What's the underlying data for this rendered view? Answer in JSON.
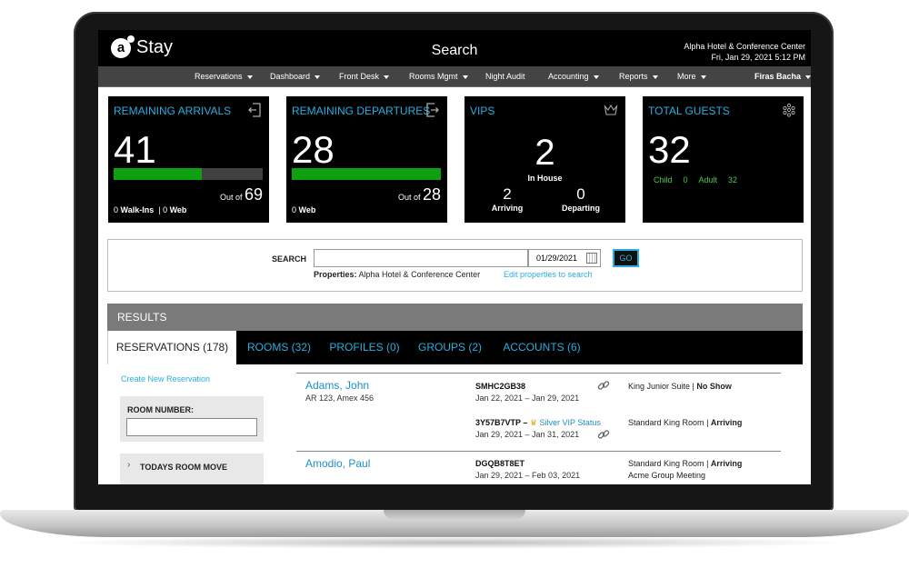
{
  "app": {
    "logo_text": "Stay",
    "logo_mark": "a",
    "page_title": "Search",
    "hotel_name": "Alpha Hotel & Conference Center",
    "datetime": "Fri, Jan 29, 2021 5:12 PM"
  },
  "nav": {
    "items": [
      "Reservations",
      "Dashboard",
      "Front Desk",
      "Rooms Mgmt",
      "Night Audit",
      "Accounting",
      "Reports",
      "More"
    ],
    "user": "Firas Bacha"
  },
  "cards": {
    "arrivals": {
      "title": "REMAINING ARRIVALS",
      "icon": "exit-door-icon",
      "value": "41",
      "out_of_label": "Out of",
      "total": "69",
      "progress": 0.59,
      "walkins": "0",
      "walkins_label": "Walk-Ins",
      "web": "0",
      "web_label": "Web"
    },
    "departures": {
      "title": "REMAINING DEPARTURES",
      "icon": "exit-door-icon",
      "value": "28",
      "out_of_label": "Out of",
      "total": "28",
      "progress": 1.0,
      "web": "0",
      "web_label": "Web"
    },
    "vips": {
      "title": "VIPS",
      "icon": "crown-icon",
      "in_house": "2",
      "in_house_label": "In House",
      "arriving": "2",
      "arriving_label": "Arriving",
      "departing": "0",
      "departing_label": "Departing"
    },
    "guests": {
      "title": "TOTAL GUESTS",
      "icon": "grid-icon",
      "value": "32",
      "child_label": "Child",
      "child": "0",
      "adult_label": "Adult",
      "adult": "32"
    }
  },
  "search": {
    "label": "SEARCH",
    "value": "",
    "date": "01/29/2021",
    "go_label": "GO",
    "properties_label": "Properties:",
    "properties_value": "Alpha Hotel & Conference Center",
    "edit_link": "Edit properties to search"
  },
  "results": {
    "header": "RESULTS",
    "tabs": [
      "RESERVATIONS (178)",
      "ROOMS (32)",
      "PROFILES (0)",
      "GROUPS (2)",
      "ACCOUNTS (6)"
    ],
    "create_link": "Create New Reservation",
    "room_number_label": "ROOM NUMBER:",
    "room_number_value": "",
    "room_move_label": "TODAYS ROOM MOVE",
    "rows": [
      {
        "name": "Adams, John",
        "detail": "AR 123, Amex 456",
        "conf": "SMHC2GB38",
        "dates": "Jan 22, 2021 – Jan 29, 2021",
        "room": "King Junior Suite",
        "status": "No Show"
      },
      {
        "conf": "3Y57B7VTP",
        "vip": "Silver VIP Status",
        "dates": "Jan 29, 2021 – Jan 31, 2021",
        "room": "Standard King Room",
        "status": "Arriving"
      },
      {
        "name": "Amodio, Paul",
        "conf": "DGQB8T8ET",
        "dates": "Jan 29, 2021 – Feb 03, 2021",
        "room": "Standard King Room",
        "status": "Arriving",
        "group": "Acme Group Meeting"
      }
    ]
  }
}
